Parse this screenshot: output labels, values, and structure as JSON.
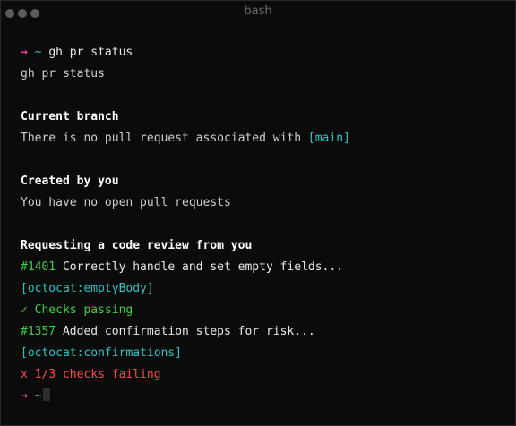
{
  "window": {
    "title": "bash"
  },
  "terminal": {
    "prompt_arrow": "→",
    "prompt_dir": "~",
    "command": "gh pr status",
    "echo": "gh pr status",
    "current_branch": {
      "heading": "Current branch",
      "text": "There is no pull request associated with ",
      "branch": "[main]"
    },
    "created_by_you": {
      "heading": "Created by you",
      "text": "You have no open pull requests"
    },
    "review_requests": {
      "heading": "Requesting a code review from you",
      "items": [
        {
          "number": "#1401",
          "title": "Correctly handle and set empty fields...",
          "branch": "[octocat:emptyBody]",
          "checks": "✓ Checks passing",
          "checks_status": "passing"
        },
        {
          "number": "#1357",
          "title": "Added confirmation steps for risk...",
          "branch": "[octocat:confirmations]",
          "checks": "x 1/3 checks failing",
          "checks_status": "failing"
        }
      ]
    }
  },
  "colors": {
    "prompt_arrow": "#ff3ea5",
    "accent_cyan": "#2bc6c2",
    "success": "#3fd13f",
    "failure": "#ff4b4b",
    "background": "#0b0b0b"
  }
}
